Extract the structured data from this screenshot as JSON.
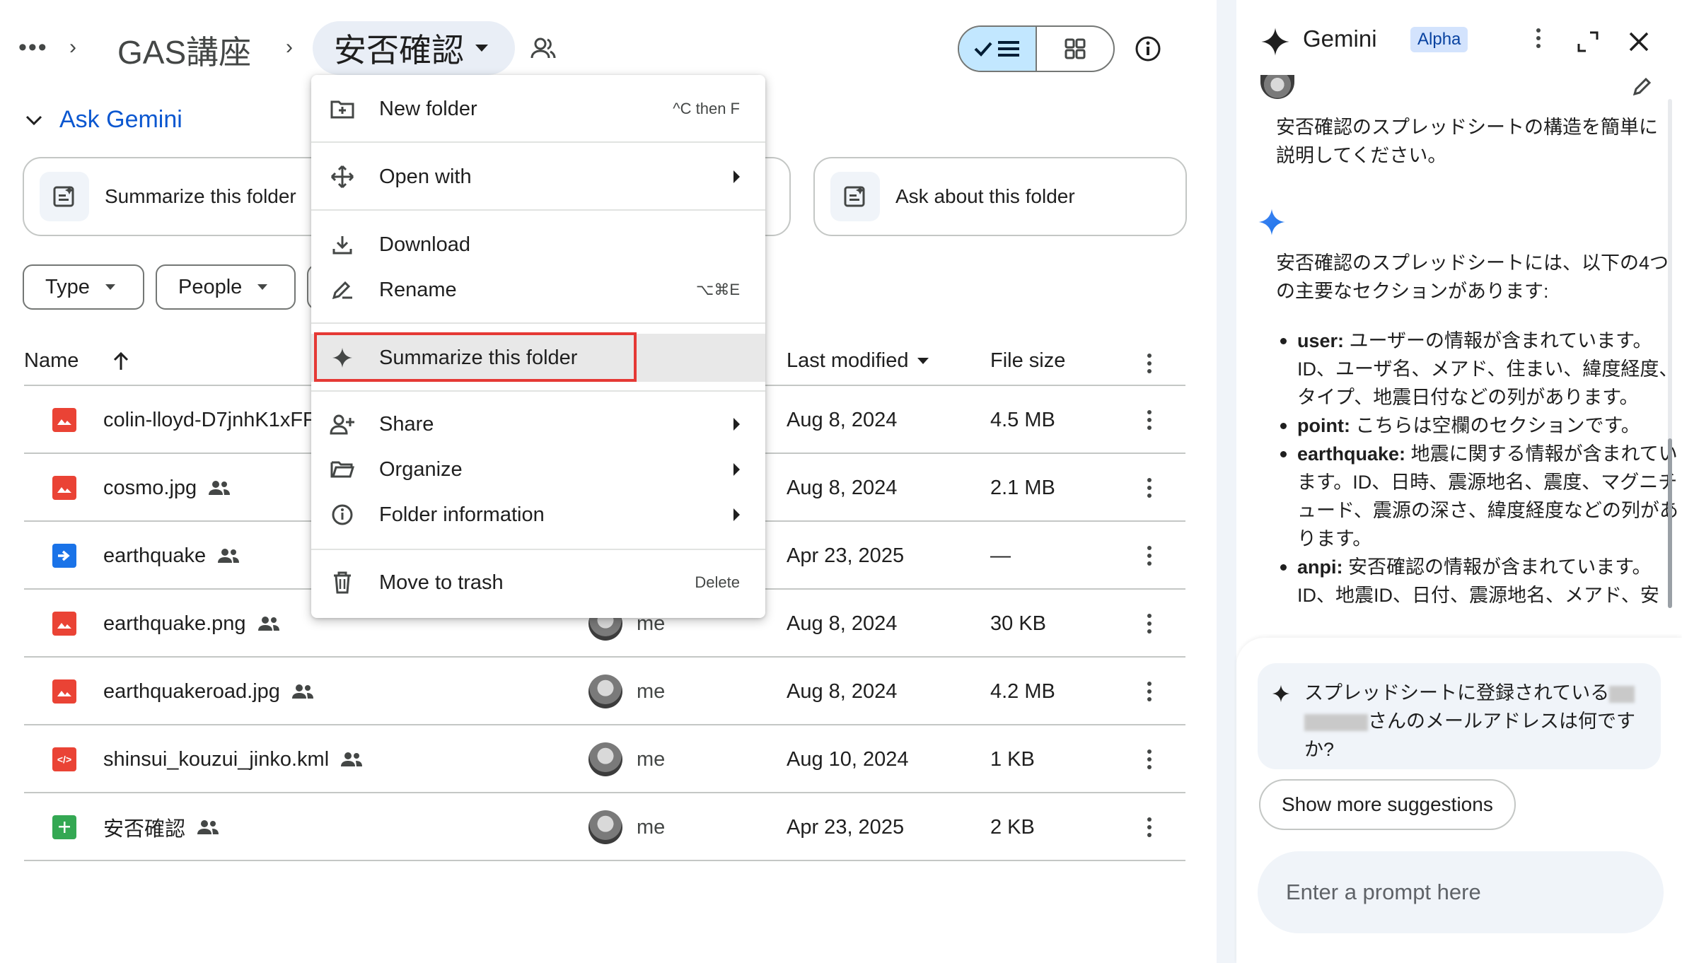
{
  "breadcrumb": {
    "more": "•••",
    "parent": "GAS講座",
    "current": "安否確認"
  },
  "ask_gemini": {
    "label": "Ask Gemini",
    "cards": [
      {
        "label": "Summarize this folder"
      },
      {
        "label": "Ask about this folder"
      }
    ]
  },
  "filters": [
    {
      "label": "Type"
    },
    {
      "label": "People"
    }
  ],
  "table": {
    "columns": {
      "name": "Name",
      "last_modified": "Last modified",
      "file_size": "File size"
    },
    "rows": [
      {
        "name": "colin-lloyd-D7jnhK1xFF",
        "icon": "image-icon",
        "shared": false,
        "owner": "",
        "modified": "Aug 8, 2024",
        "size": "4.5 MB"
      },
      {
        "name": "cosmo.jpg",
        "icon": "image-icon",
        "shared": true,
        "owner": "",
        "modified": "Aug 8, 2024",
        "size": "2.1 MB"
      },
      {
        "name": "earthquake",
        "icon": "apps-script-icon",
        "shared": true,
        "owner": "",
        "modified": "Apr 23, 2025",
        "size": "—"
      },
      {
        "name": "earthquake.png",
        "icon": "image-icon",
        "shared": true,
        "owner": "me",
        "modified": "Aug 8, 2024",
        "size": "30 KB"
      },
      {
        "name": "earthquakeroad.jpg",
        "icon": "image-icon",
        "shared": true,
        "owner": "me",
        "modified": "Aug 8, 2024",
        "size": "4.2 MB"
      },
      {
        "name": "shinsui_kouzui_jinko.kml",
        "icon": "code-file-icon",
        "shared": true,
        "owner": "me",
        "modified": "Aug 10, 2024",
        "size": "1 KB"
      },
      {
        "name": "安否確認",
        "icon": "sheets-icon",
        "shared": true,
        "owner": "me",
        "modified": "Apr 23, 2025",
        "size": "2 KB"
      }
    ]
  },
  "menu": {
    "new_folder": {
      "label": "New folder",
      "shortcut": "^C then F"
    },
    "open_with": {
      "label": "Open with"
    },
    "download": {
      "label": "Download"
    },
    "rename": {
      "label": "Rename",
      "shortcut": "⌥⌘E"
    },
    "summarize": {
      "label": "Summarize this folder"
    },
    "share": {
      "label": "Share"
    },
    "organize": {
      "label": "Organize"
    },
    "folder_info": {
      "label": "Folder information"
    },
    "trash": {
      "label": "Move to trash",
      "shortcut": "Delete"
    }
  },
  "gemini": {
    "title": "Gemini",
    "badge": "Alpha",
    "user_prompt": "安否確認のスプレッドシートの構造を簡単に説明してください。",
    "response_intro": "安否確認のスプレッドシートには、以下の4つの主要なセクションがあります:",
    "sections": [
      {
        "key": "user:",
        "text": " ユーザーの情報が含まれています。ID、ユーザ名、メアド、住まい、緯度経度、タイプ、地震日付などの列があります。"
      },
      {
        "key": "point:",
        "text": " こちらは空欄のセクションです。"
      },
      {
        "key": "earthquake:",
        "text": " 地震に関する情報が含まれています。ID、日時、震源地名、震度、マグニチュード、震源の深さ、緯度経度などの列があります。"
      },
      {
        "key": "anpi:",
        "text": " 安否確認の情報が含まれています。ID、地震ID、日付、震源地名、メアド、安"
      }
    ],
    "suggestion_prefix": "スプレッドシートに登録されている",
    "suggestion_suffix": "さんのメールアドレスは何ですか?",
    "show_more": "Show more suggestions",
    "input_placeholder": "Enter a prompt here"
  },
  "colors": {
    "accent_blue": "#0b57d0",
    "list_view_active": "#c2e7ff",
    "highlight_red": "#e53935",
    "image_red": "#ea4335",
    "sheets_green": "#34a853",
    "script_blue": "#1a73e8"
  }
}
